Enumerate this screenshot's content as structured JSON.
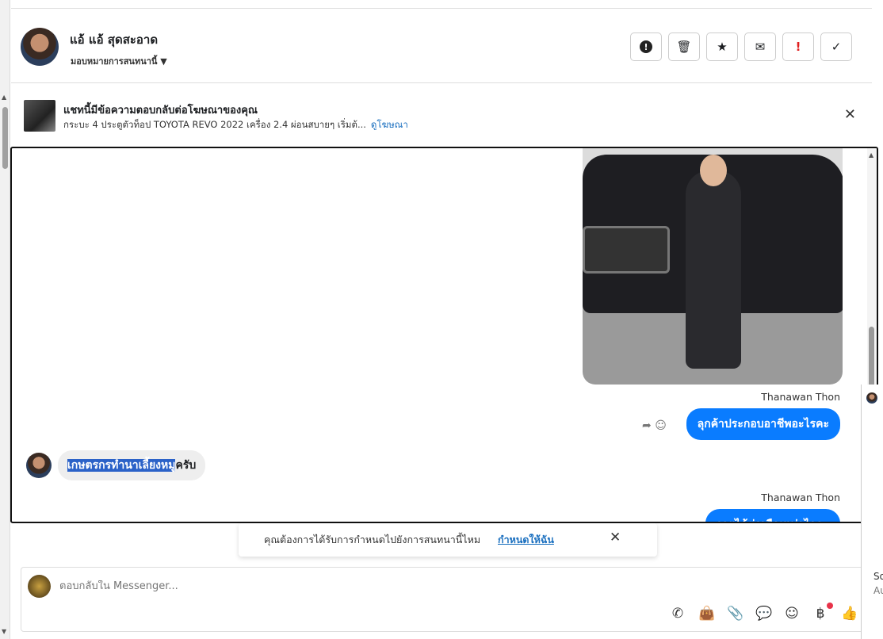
{
  "contact": {
    "name": "แอ้ แอ้ สุดสะอาด",
    "assign_label": "มอบหมายการสนทนานี้"
  },
  "actions": [
    {
      "name": "report-spam-button",
      "glyph": "!"
    },
    {
      "name": "delete-button",
      "glyph": "🗑"
    },
    {
      "name": "star-button",
      "glyph": "★"
    },
    {
      "name": "mark-unread-button",
      "glyph": "✉"
    },
    {
      "name": "important-button",
      "glyph": "!"
    },
    {
      "name": "mark-done-button",
      "glyph": "✓"
    }
  ],
  "ad": {
    "title": "แชทนี้มีข้อความตอบกลับต่อโฆษณาของคุณ",
    "description": "กระบะ 4 ประตูตัวท็อป TOYOTA REVO 2022 เครื่อง 2.4 ผ่อนสบายๆ เริ่มต้...",
    "link": "ดูโฆษณา"
  },
  "messages": {
    "sender1": "Thanawan Thon",
    "out1": "ลุกค้าประกอบอาชีพอะไรคะ",
    "in1_highlight": "เกษตรกรทำนาเลี้ยงหมู",
    "in1_rest": "ครับ",
    "sender2": "Thanawan Thon",
    "out2": "รายได้ต่อเดือนเท่าไรคะ"
  },
  "toast": {
    "text": "คุณต้องการได้รับการกำหนดไปยังการสนทนานี้ไหม",
    "link": "กำหนดให้ฉัน"
  },
  "composer": {
    "placeholder": "ตอบกลับใน Messenger..."
  },
  "side": {
    "line1": "So",
    "line2": "Au"
  },
  "colors": {
    "accent": "#0a7cff",
    "link": "#1a6fbf",
    "notification": "#e8334a"
  }
}
